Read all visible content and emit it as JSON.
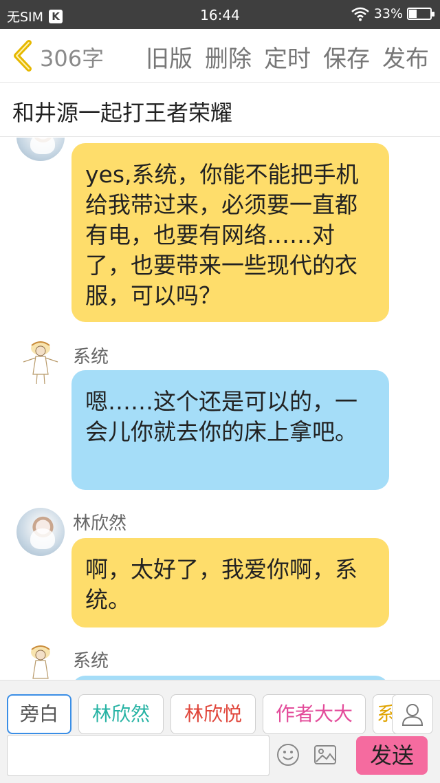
{
  "status_bar": {
    "carrier": "无SIM",
    "k_badge": "K",
    "time": "16:44",
    "battery_text": "33%",
    "battery_level": 0.33
  },
  "toolbar": {
    "word_count": "306字",
    "actions": [
      "旧版",
      "删除",
      "定时",
      "保存",
      "发布"
    ]
  },
  "title": "和井源一起打王者荣耀",
  "messages": [
    {
      "sender": "",
      "color": "#fedd6b",
      "text": "yes,系统，你能不能把手机给我带过来，必须要一直都有电，也要有网络……对了，也要带来一些现代的衣服，可以吗？"
    },
    {
      "sender": "系统",
      "color": "#a5ddf8",
      "text": "嗯……这个还是可以的，一会儿你就去你的床上拿吧。"
    },
    {
      "sender": "林欣然",
      "color": "#fedd6b",
      "text": "啊，太好了，我爱你啊，系统。"
    },
    {
      "sender": "系统",
      "color": "#a5ddf8",
      "text": ""
    }
  ],
  "characters": [
    {
      "label": "旁白",
      "color": "#555555"
    },
    {
      "label": "林欣然",
      "color": "#27b3a4"
    },
    {
      "label": "林欣悦",
      "color": "#e0463b"
    },
    {
      "label": "作者大大",
      "color": "#e34b9a"
    },
    {
      "label": "系",
      "color": "#e0a300"
    }
  ],
  "input": {
    "value": "",
    "send_label": "发送"
  },
  "colors": {
    "accent": "#f56b9f",
    "yellow_bubble": "#fedd6b",
    "blue_bubble": "#a5ddf8"
  }
}
